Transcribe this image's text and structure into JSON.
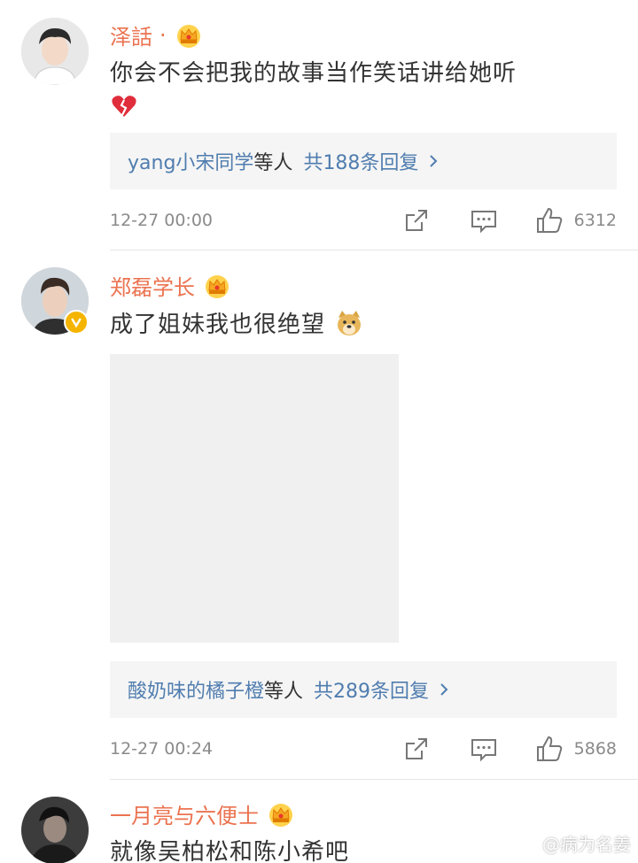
{
  "comments": [
    {
      "username": "泽話",
      "separator": "·",
      "text": "你会不会把我的故事当作笑话讲给她听",
      "emoji": "broken-heart-icon",
      "reply_names": "yang小宋同学",
      "reply_sep": "等人",
      "reply_count": "共188条回复",
      "timestamp": "12-27 00:00",
      "likes": "6312"
    },
    {
      "username": "郑磊学长",
      "text": "成了姐妹我也很绝望",
      "emoji": "doge-icon",
      "verified": true,
      "reply_names": "酸奶味的橘子橙",
      "reply_sep": "等人",
      "reply_count": "共289条回复",
      "timestamp": "12-27 00:24",
      "likes": "5868"
    },
    {
      "username": "一月亮与六便士",
      "text": "就像吴柏松和陈小希吧"
    }
  ],
  "watermark": "@病为名姜",
  "colors": {
    "username": "#eb7350",
    "link": "#507daf",
    "text": "#333333",
    "meta": "#8a8a8a",
    "reply_bg": "#f5f5f5"
  }
}
